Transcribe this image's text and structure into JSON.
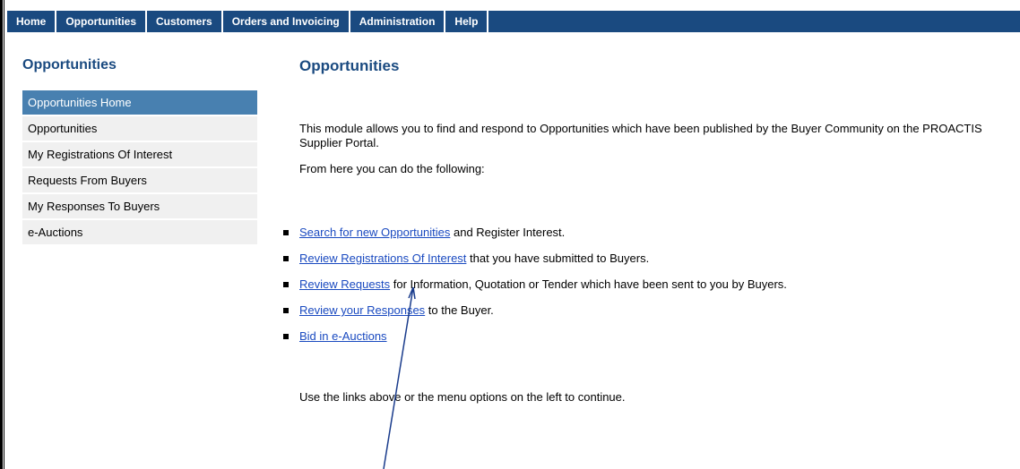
{
  "nav": {
    "items": [
      {
        "label": "Home",
        "name": "nav-home"
      },
      {
        "label": "Opportunities",
        "name": "nav-opportunities"
      },
      {
        "label": "Customers",
        "name": "nav-customers"
      },
      {
        "label": "Orders and Invoicing",
        "name": "nav-orders-invoicing"
      },
      {
        "label": "Administration",
        "name": "nav-administration"
      },
      {
        "label": "Help",
        "name": "nav-help"
      }
    ]
  },
  "sidebar": {
    "title": "Opportunities",
    "items": [
      {
        "label": "Opportunities Home",
        "active": true
      },
      {
        "label": "Opportunities"
      },
      {
        "label": "My Registrations Of Interest"
      },
      {
        "label": "Requests From Buyers"
      },
      {
        "label": "My Responses To Buyers"
      },
      {
        "label": "e-Auctions"
      }
    ]
  },
  "main": {
    "title": "Opportunities",
    "intro": "This module allows you to find and respond to Opportunities which have been published by the Buyer Community on the PROACTIS Supplier Portal.",
    "subintro": "From here you can do the following:",
    "bullets": [
      {
        "link": "Search for new Opportunities",
        "rest": " and Register Interest."
      },
      {
        "link": "Review Registrations Of Interest",
        "rest": " that you have submitted to Buyers."
      },
      {
        "link": "Review Requests",
        "rest": " for Information, Quotation or Tender which have been sent to you by Buyers."
      },
      {
        "link": "Review your Responses",
        "rest": " to the Buyer."
      },
      {
        "link": "Bid in e-Auctions",
        "rest": ""
      }
    ],
    "outro": "Use the links above or the menu options on the left to continue."
  },
  "colors": {
    "nav_bg": "#1a4a80",
    "active_item": "#4880b0",
    "link": "#1a4ac0",
    "heading": "#1a4a80"
  }
}
